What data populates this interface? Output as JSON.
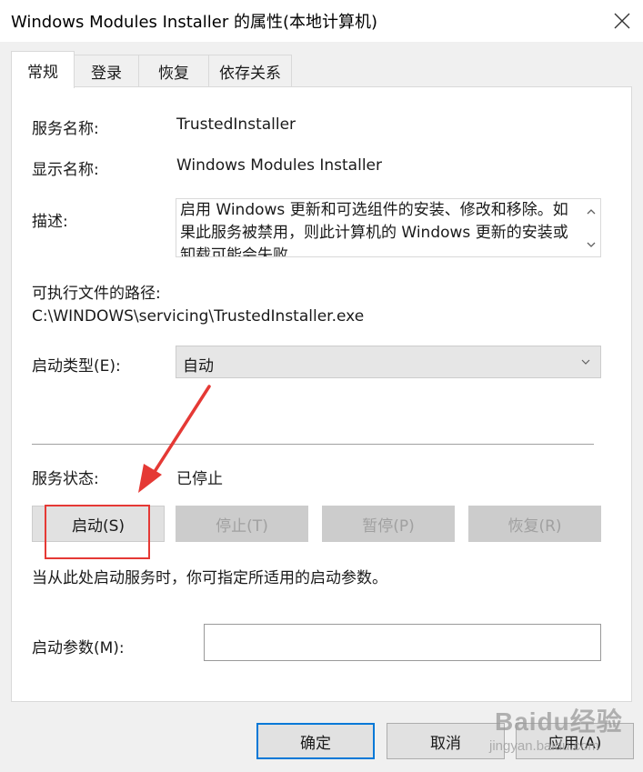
{
  "window": {
    "title": "Windows Modules Installer 的属性(本地计算机)"
  },
  "tabs": [
    {
      "label": "常规",
      "active": true
    },
    {
      "label": "登录",
      "active": false
    },
    {
      "label": "恢复",
      "active": false
    },
    {
      "label": "依存关系",
      "active": false
    }
  ],
  "general": {
    "service_name_label": "服务名称:",
    "service_name_value": "TrustedInstaller",
    "display_name_label": "显示名称:",
    "display_name_value": "Windows Modules Installer",
    "description_label": "描述:",
    "description_value": "启用 Windows 更新和可选组件的安装、修改和移除。如果此服务被禁用，则此计算机的 Windows 更新的安装或卸载可能会失败",
    "exe_path_label": "可执行文件的路径:",
    "exe_path_value": "C:\\WINDOWS\\servicing\\TrustedInstaller.exe",
    "startup_type_label": "启动类型(E):",
    "startup_type_value": "自动",
    "service_status_label": "服务状态:",
    "service_status_value": "已停止",
    "buttons": {
      "start": "启动(S)",
      "stop": "停止(T)",
      "pause": "暂停(P)",
      "resume": "恢复(R)"
    },
    "hint_text": "当从此处启动服务时，你可指定所适用的启动参数。",
    "start_params_label": "启动参数(M):",
    "start_params_value": ""
  },
  "footer": {
    "ok": "确定",
    "cancel": "取消",
    "apply": "应用(A)"
  },
  "watermark": {
    "brand": "Baidu经验",
    "url": "jingyan.baidu.com"
  },
  "colors": {
    "annotation": "#e53935",
    "accent": "#0078d7",
    "dialog_bg": "#f0f0f0"
  }
}
